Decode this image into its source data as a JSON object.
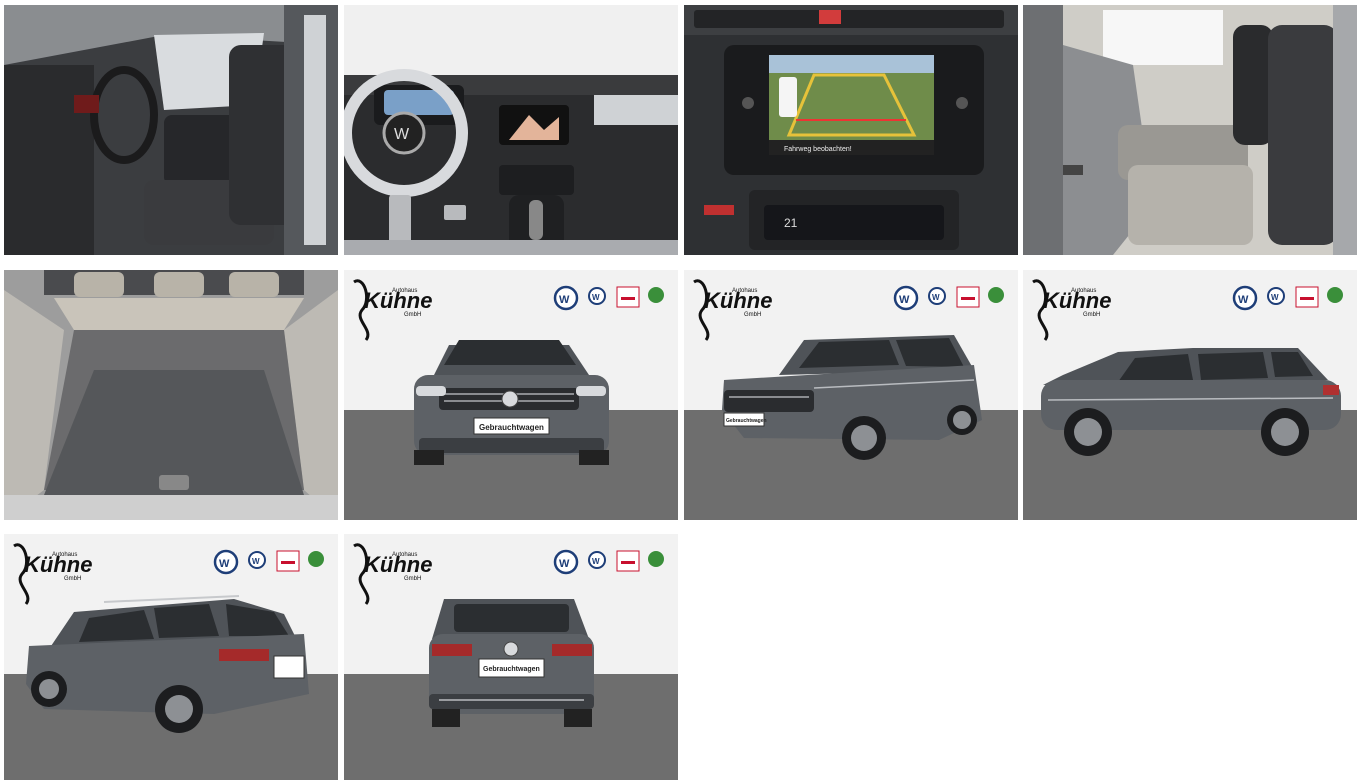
{
  "dealer": {
    "logo_text": "Kühne",
    "logo_top": "Autohaus",
    "logo_sub": "GmbH"
  },
  "brands": [
    "VW",
    "VW Nutzfahrzeuge",
    "Audi",
    "Skoda"
  ],
  "plate_text": "Gebrauchtwagen",
  "camera_warning": "Fahrweg beobachten!",
  "climate_temp": "21",
  "photos": [
    {
      "id": "interior-front",
      "kind": "interior"
    },
    {
      "id": "cockpit",
      "kind": "interior"
    },
    {
      "id": "infotainment",
      "kind": "interior"
    },
    {
      "id": "rear-seats",
      "kind": "interior"
    },
    {
      "id": "trunk",
      "kind": "interior"
    },
    {
      "id": "front",
      "kind": "exterior"
    },
    {
      "id": "front-three-quarter",
      "kind": "exterior"
    },
    {
      "id": "side",
      "kind": "exterior"
    },
    {
      "id": "rear-three-quarter",
      "kind": "exterior"
    },
    {
      "id": "rear",
      "kind": "exterior"
    }
  ],
  "colors": {
    "car_body": "#5d6166",
    "floor": "#6e6e6e",
    "wall": "#f2f2f2",
    "vw_blue": "#1e3e78",
    "audi_red": "#c8102e",
    "skoda_green": "#3a8f3a"
  }
}
